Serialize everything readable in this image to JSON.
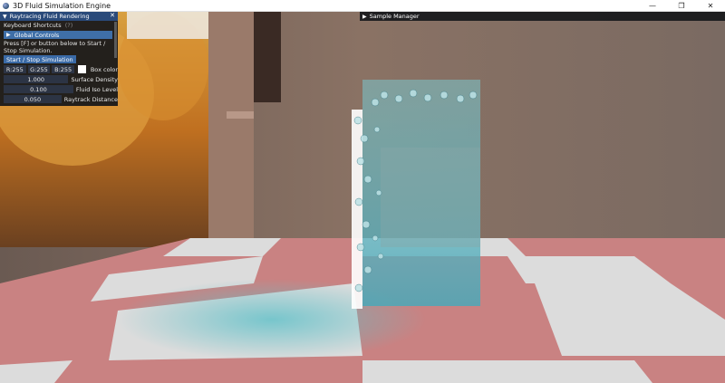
{
  "window": {
    "title": "3D Fluid Simulation Engine",
    "controls": [
      "—",
      "❐",
      "✕"
    ]
  },
  "fluid_panel": {
    "title": "Raytracing Fluid Rendering",
    "close_glyph": "✕",
    "keyboard_label": "Keyboard Shortcuts",
    "keyboard_hint": "(?)",
    "global_controls_label": "Global Controls",
    "press_text_1": "Press [F] or button below to Start /",
    "press_text_2": "Stop Simulation.",
    "start_button": "Start / Stop Simulation",
    "color": {
      "r": "R:255",
      "g": "G:255",
      "b": "B:255",
      "label": "Box color",
      "swatch": "#ffffff"
    },
    "params": [
      {
        "value": "1.000",
        "label": "Surface Density"
      },
      {
        "value": "0.100",
        "label": "Fluid Iso Level"
      },
      {
        "value": "0.050",
        "label": "Raytrack Distance"
      }
    ]
  },
  "sample_panel": {
    "title": "Sample Manager"
  },
  "colors": {
    "title_bar_active": "#2a4a7a",
    "header_button": "#3f6fa8",
    "fluid": "#5fb8c8",
    "floor_red": "#c98282",
    "floor_white": "#dcdcdc"
  }
}
